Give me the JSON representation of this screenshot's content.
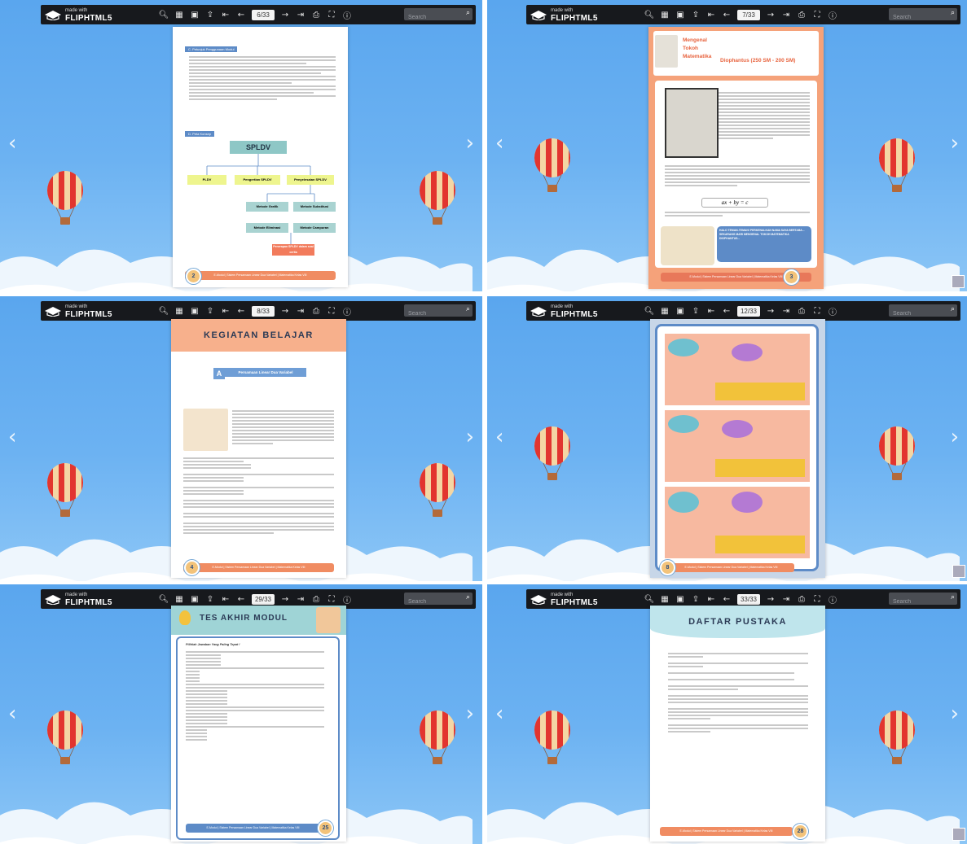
{
  "toolbar": {
    "brand_small": "made with",
    "brand_big": "FLIPHTML5",
    "search_placeholder": "Search",
    "icons": [
      "zoom-icon",
      "thumbnails-icon",
      "bookmark-icon",
      "share-icon",
      "first-page-icon",
      "prev-page-icon",
      "next-page-icon",
      "last-page-icon",
      "print-icon",
      "fullscreen-icon",
      "info-icon"
    ]
  },
  "panels": [
    {
      "page_indicator": "6/33",
      "page_number": "2",
      "section_c": "C.  Petunjuk Penggunaan Modul",
      "section_d": "D.  Peta Konsep",
      "map_root": "SPLDV",
      "map_l1": [
        "PLDV",
        "Pengertian SPLDV",
        "Penyelesaian SPLDV"
      ],
      "map_l2": [
        "Metode Grafik",
        "Metode Substitusi",
        "Metode Eliminasi",
        "Metode Campuran"
      ],
      "map_l3": "Penerapan SPLDV dalam soal cerita",
      "footer": "E-Modul | Sistem Persamaan Linear Dua Variabel | Matematika Kelas VIII"
    },
    {
      "page_indicator": "7/33",
      "page_number": "3",
      "heading_left": "Mengenal Tokoh Matematika",
      "heading_right": "Diophantus (250 SM - 200 SM)",
      "equation": "ax + by = c",
      "speech": "HALO TEMAN-TEMAN! PERKENALKAN NAMA SAYA BERTABA... SEKARANG MARI MENGENAL TOKOH MATEMATIKA DIOPHANTUS...",
      "footer": "E-Modul | Sistem Persamaan Linear Dua Variabel | Matematika Kelas VIII"
    },
    {
      "page_indicator": "8/33",
      "page_number": "4",
      "heading": "KEGIATAN BELAJAR",
      "badge_letter": "A",
      "subheading": "Persamaan Linear Dua Variabel",
      "footer": "E-Modul | Sistem Persamaan Linear Dua Variabel | Matematika Kelas VIII"
    },
    {
      "page_indicator": "12/33",
      "page_number": "8",
      "footer": "E-Modul | Sistem Persamaan Linear Dua Variabel | Matematika Kelas VIII"
    },
    {
      "page_indicator": "29/33",
      "page_number": "25",
      "heading": "TES AKHIR MODUL",
      "instruction": "Pilihlah Jawaban Yang Paling Tepat !",
      "footer": "E-Modul | Sistem Persamaan Linear Dua Variabel | Matematika Kelas VIII"
    },
    {
      "page_indicator": "33/33",
      "page_number": "28",
      "heading": "DAFTAR PUSTAKA",
      "footer": "E-Modul | Sistem Persamaan Linear Dua Variabel | Matematika Kelas VIII"
    }
  ]
}
